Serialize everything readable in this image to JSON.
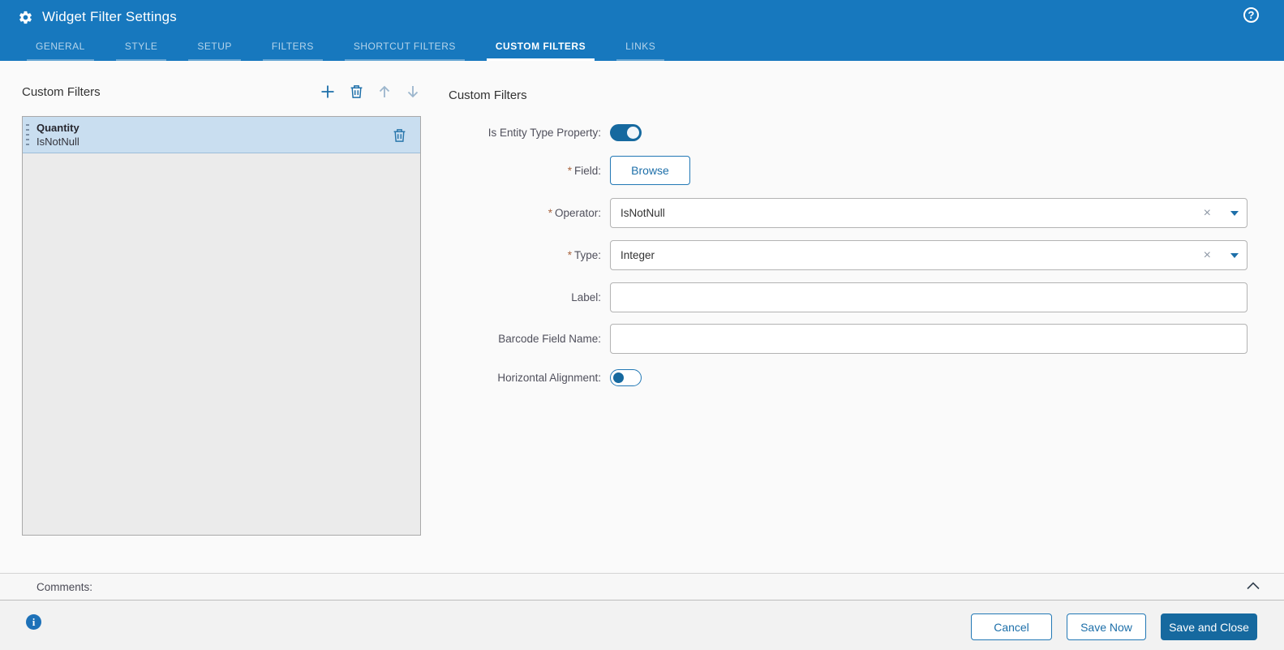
{
  "colors": {
    "header_blue": "#1778be",
    "accent_blue": "#16699f",
    "link_blue": "#1d6fa9",
    "selected_item_bg": "#c9def0",
    "panel_bg": "#ebebeb",
    "required_marker_color": "#a9653f"
  },
  "icons": {
    "settings": "gear-icon",
    "help_glyph": "?",
    "info_glyph": "i",
    "clear_glyph": "×",
    "add": "plus-icon",
    "delete": "trash-icon",
    "move_up": "arrow-up-icon",
    "move_down": "arrow-down-icon",
    "collapse": "chevron-up-icon",
    "drag": "drag-handle-icon",
    "dropdown": "caret-down-icon"
  },
  "header": {
    "title": "Widget Filter Settings",
    "tabs": [
      {
        "label": "GENERAL",
        "active": false
      },
      {
        "label": "STYLE",
        "active": false
      },
      {
        "label": "SETUP",
        "active": false
      },
      {
        "label": "FILTERS",
        "active": false
      },
      {
        "label": "SHORTCUT FILTERS",
        "active": false
      },
      {
        "label": "CUSTOM FILTERS",
        "active": true
      },
      {
        "label": "LINKS",
        "active": false
      }
    ]
  },
  "left_panel": {
    "title": "Custom Filters",
    "items": [
      {
        "title": "Quantity",
        "subtitle": "IsNotNull",
        "selected": true
      }
    ]
  },
  "form": {
    "title": "Custom Filters",
    "required_marker": "*",
    "fields": {
      "is_entity_type_property": {
        "label": "Is Entity Type Property:",
        "type": "toggle",
        "value": "on"
      },
      "field": {
        "label": "Field:",
        "required": true,
        "button_label": "Browse"
      },
      "operator": {
        "label": "Operator:",
        "required": true,
        "value": "IsNotNull"
      },
      "type": {
        "label": "Type:",
        "required": true,
        "value": "Integer"
      },
      "label": {
        "label": "Label:",
        "value": ""
      },
      "barcode_field_name": {
        "label": "Barcode Field Name:",
        "value": ""
      },
      "horizontal_alignment": {
        "label": "Horizontal Alignment:",
        "type": "toggle",
        "value": "off"
      }
    }
  },
  "comments": {
    "label": "Comments:"
  },
  "footer": {
    "cancel_label": "Cancel",
    "save_now_label": "Save Now",
    "save_and_close_label": "Save and Close"
  }
}
